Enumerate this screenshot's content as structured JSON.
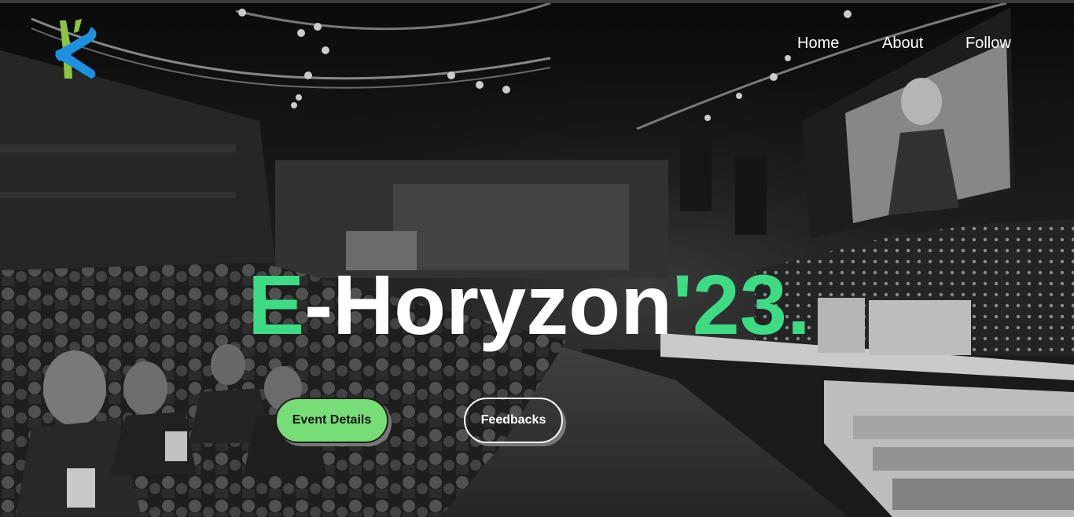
{
  "brand": {
    "logo_icon": "eh-logo-icon",
    "colors": {
      "blue": "#1e90e0",
      "green": "#8cc63f"
    }
  },
  "nav": {
    "items": [
      "Home",
      "About",
      "Follow"
    ]
  },
  "hero": {
    "title_prefix": "E",
    "title_middle": "-Horyzon",
    "title_suffix": "'23.",
    "accent_color": "#3ddc84",
    "background": "black-and-white conference hall photo"
  },
  "buttons": {
    "primary": "Event Details",
    "secondary": "Feedbacks"
  }
}
